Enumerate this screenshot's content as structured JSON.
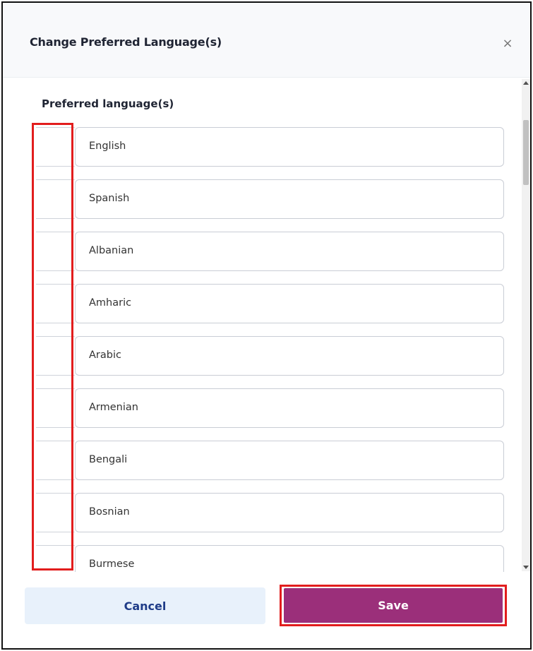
{
  "modal": {
    "title": "Change Preferred Language(s)",
    "close_glyph": "×"
  },
  "section": {
    "label": "Preferred language(s)"
  },
  "languages": [
    {
      "label": "English"
    },
    {
      "label": "Spanish"
    },
    {
      "label": "Albanian"
    },
    {
      "label": "Amharic"
    },
    {
      "label": "Arabic"
    },
    {
      "label": "Armenian"
    },
    {
      "label": "Bengali"
    },
    {
      "label": "Bosnian"
    },
    {
      "label": "Burmese"
    }
  ],
  "footer": {
    "cancel_label": "Cancel",
    "save_label": "Save"
  },
  "colors": {
    "save_bg": "#9b2f7a",
    "cancel_bg": "#e8f1fb",
    "highlight": "#e21d1d"
  }
}
